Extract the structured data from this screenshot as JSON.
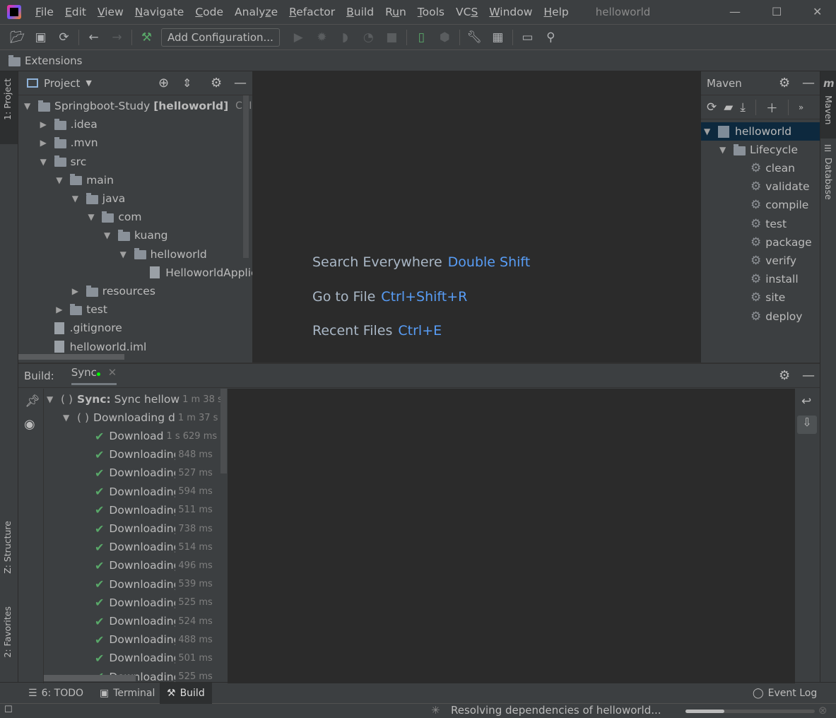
{
  "window": {
    "title": "helloworld"
  },
  "menu": [
    {
      "pre": "",
      "u": "F",
      "post": "ile"
    },
    {
      "pre": "",
      "u": "E",
      "post": "dit"
    },
    {
      "pre": "",
      "u": "V",
      "post": "iew"
    },
    {
      "pre": "",
      "u": "N",
      "post": "avigate"
    },
    {
      "pre": "",
      "u": "C",
      "post": "ode"
    },
    {
      "pre": "Analy",
      "u": "z",
      "post": "e"
    },
    {
      "pre": "",
      "u": "R",
      "post": "efactor"
    },
    {
      "pre": "",
      "u": "B",
      "post": "uild"
    },
    {
      "pre": "R",
      "u": "u",
      "post": "n"
    },
    {
      "pre": "",
      "u": "T",
      "post": "ools"
    },
    {
      "pre": "VC",
      "u": "S",
      "post": ""
    },
    {
      "pre": "",
      "u": "W",
      "post": "indow"
    },
    {
      "pre": "",
      "u": "H",
      "post": "elp"
    }
  ],
  "toolbar": {
    "add_configuration": "Add Configuration..."
  },
  "navbar": {
    "crumb": "Extensions"
  },
  "left_strip": {
    "project_tab": "1: Project",
    "structure_tab": "Z: Structure",
    "favorites_tab": "2: Favorites"
  },
  "project": {
    "title": "Project",
    "tree": [
      {
        "level": 0,
        "state": "open",
        "type": "module",
        "label": "Springboot-Study",
        "bold": "[helloworld]",
        "path": "C:\\IDE"
      },
      {
        "level": 1,
        "state": "closed",
        "type": "folder",
        "label": ".idea"
      },
      {
        "level": 1,
        "state": "closed",
        "type": "folder",
        "label": ".mvn"
      },
      {
        "level": 1,
        "state": "open",
        "type": "folder",
        "label": "src"
      },
      {
        "level": 2,
        "state": "open",
        "type": "folder",
        "label": "main"
      },
      {
        "level": 3,
        "state": "open",
        "type": "folder",
        "label": "java"
      },
      {
        "level": 4,
        "state": "open",
        "type": "folder",
        "label": "com"
      },
      {
        "level": 5,
        "state": "open",
        "type": "folder",
        "label": "kuang"
      },
      {
        "level": 6,
        "state": "open",
        "type": "folder",
        "label": "helloworld"
      },
      {
        "level": 7,
        "state": "none",
        "type": "file",
        "label": "HelloworldApplic"
      },
      {
        "level": 3,
        "state": "closed",
        "type": "folder",
        "label": "resources"
      },
      {
        "level": 2,
        "state": "closed",
        "type": "folder",
        "label": "test"
      },
      {
        "level": 1,
        "state": "none",
        "type": "file",
        "label": ".gitignore"
      },
      {
        "level": 1,
        "state": "none",
        "type": "file",
        "label": "helloworld.iml"
      }
    ]
  },
  "editor": {
    "hints": [
      {
        "text": "Search Everywhere",
        "key": "Double Shift"
      },
      {
        "text": "Go to File",
        "key": "Ctrl+Shift+R"
      },
      {
        "text": "Recent Files",
        "key": "Ctrl+E"
      }
    ]
  },
  "maven": {
    "title": "Maven",
    "project": "helloworld",
    "lifecycle": "Lifecycle",
    "goals": [
      "clean",
      "validate",
      "compile",
      "test",
      "package",
      "verify",
      "install",
      "site",
      "deploy"
    ]
  },
  "right_strip": {
    "maven_tab": "Maven",
    "database_tab": "Database"
  },
  "build": {
    "label": "Build:",
    "tab": "Sync",
    "root": {
      "bold": "Sync:",
      "text": "Sync hellow",
      "time": "1 m 38 s"
    },
    "child": {
      "text": "Downloading d",
      "time": "1 m 37 s"
    },
    "items": [
      {
        "text": "Download",
        "time": "1 s 629 ms"
      },
      {
        "text": "Downloading",
        "time": "848 ms"
      },
      {
        "text": "Downloading",
        "time": "527 ms"
      },
      {
        "text": "Downloading",
        "time": "594 ms"
      },
      {
        "text": "Downloading",
        "time": "511 ms"
      },
      {
        "text": "Downloading",
        "time": "738 ms"
      },
      {
        "text": "Downloading",
        "time": "514 ms"
      },
      {
        "text": "Downloading",
        "time": "496 ms"
      },
      {
        "text": "Downloading",
        "time": "539 ms"
      },
      {
        "text": "Downloading",
        "time": "525 ms"
      },
      {
        "text": "Downloading",
        "time": "524 ms"
      },
      {
        "text": "Downloading",
        "time": "488 ms"
      },
      {
        "text": "Downloading",
        "time": "501 ms"
      },
      {
        "text": "Downloading",
        "time": "525 ms"
      }
    ]
  },
  "bottom_tabs": {
    "todo": "6: TODO",
    "terminal": "Terminal",
    "build": "Build",
    "event_log": "Event Log"
  },
  "status": {
    "text": "Resolving dependencies of helloworld...",
    "progress_percent": 30
  },
  "colors": {
    "accent": "#589df6",
    "success": "#59a869",
    "selection": "#0d293e"
  }
}
